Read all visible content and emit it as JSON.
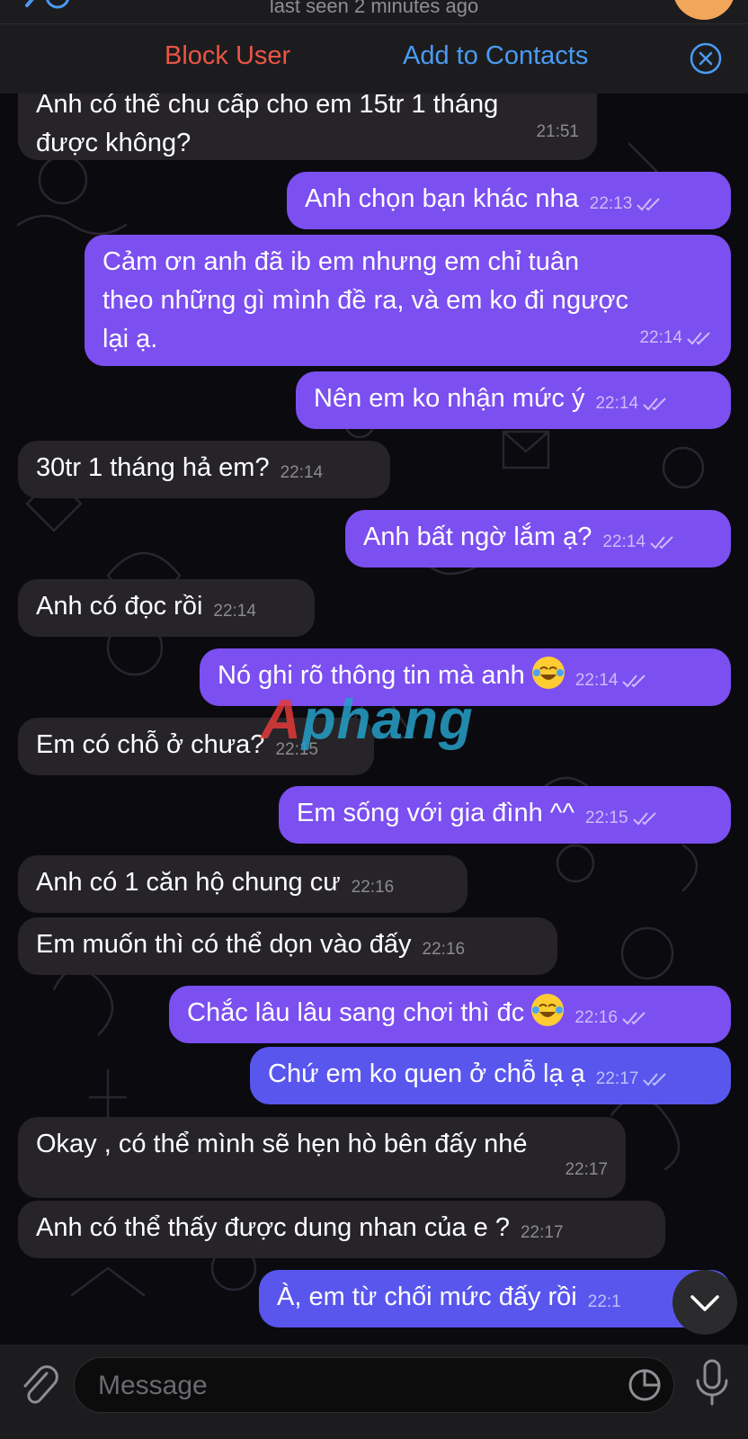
{
  "header": {
    "last_seen": "last seen 2 minutes ago",
    "block_user": "Block User",
    "add_to_contacts": "Add to Contacts"
  },
  "messages": [
    {
      "id": "m0",
      "dir": "in",
      "text": "Anh có thể chu cấp cho em 15tr 1 tháng\nđược không?",
      "time": "21:51"
    },
    {
      "id": "m1",
      "dir": "out",
      "text": "Anh chọn bạn khác nha",
      "time": "22:13"
    },
    {
      "id": "m2",
      "dir": "out",
      "text": "Cảm ơn anh đã ib em nhưng em chỉ tuân\ntheo những gì mình đề ra, và em ko đi ngược\nlại ạ.",
      "time": "22:14"
    },
    {
      "id": "m3",
      "dir": "out",
      "text": "Nên em ko nhận mức ý",
      "time": "22:14"
    },
    {
      "id": "m4",
      "dir": "in",
      "text": "30tr 1 tháng hả em?",
      "time": "22:14"
    },
    {
      "id": "m5",
      "dir": "out",
      "text": "Anh bất ngờ lắm ạ?",
      "time": "22:14"
    },
    {
      "id": "m6",
      "dir": "in",
      "text": "Anh có đọc rồi",
      "time": "22:14"
    },
    {
      "id": "m7",
      "dir": "out",
      "text": "Nó ghi rõ thông tin mà anh",
      "time": "22:14",
      "emoji": "face-with-tears-of-joy"
    },
    {
      "id": "m8",
      "dir": "in",
      "text": "Em có chỗ ở chưa?",
      "time": "22:15"
    },
    {
      "id": "m9",
      "dir": "out",
      "text": "Em sống với gia đình ^^",
      "time": "22:15"
    },
    {
      "id": "m10",
      "dir": "in",
      "text": "Anh có 1 căn hộ chung cư",
      "time": "22:16"
    },
    {
      "id": "m11",
      "dir": "in",
      "text": "Em muốn thì có thể dọn vào đấy",
      "time": "22:16"
    },
    {
      "id": "m12",
      "dir": "out",
      "text": "Chắc lâu lâu sang chơi thì đc",
      "time": "22:16",
      "emoji": "face-with-tears-of-joy"
    },
    {
      "id": "m13",
      "dir": "out",
      "text": "Chứ em ko quen ở chỗ lạ ạ",
      "time": "22:17"
    },
    {
      "id": "m14",
      "dir": "in",
      "text": "Okay , có thể mình sẽ hẹn hò bên đấy nhé",
      "time": "22:17"
    },
    {
      "id": "m15",
      "dir": "in",
      "text": "Anh có thể thấy được dung nhan của e ?",
      "time": "22:17"
    },
    {
      "id": "m16",
      "dir": "out",
      "text": "À, em từ chối mức đấy rồi",
      "time": "22:1"
    }
  ],
  "watermark": {
    "part_a": "A",
    "part_b": "phang"
  },
  "composer": {
    "placeholder": "Message"
  },
  "colors": {
    "outgoing_bubble": "#7b4ff0",
    "incoming_bubble": "#262428",
    "block_red": "#eb5545",
    "link_blue": "#4a9bf2"
  },
  "icons": [
    "back-chevron-icon",
    "close-circle-icon",
    "read-ticks-icon",
    "paperclip-icon",
    "sticker-icon",
    "microphone-icon",
    "chevron-down-icon"
  ]
}
